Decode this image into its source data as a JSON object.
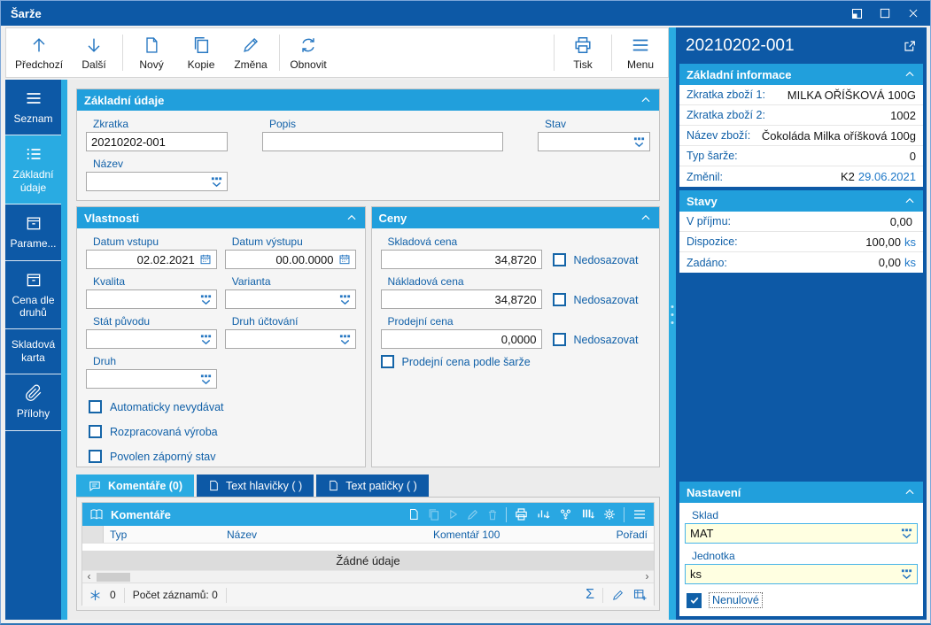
{
  "window": {
    "title": "Šarže"
  },
  "toolbar": {
    "buttons": [
      {
        "label": "Předchozí",
        "icon": "arrow-up-icon"
      },
      {
        "label": "Další",
        "icon": "arrow-down-icon"
      },
      {
        "label": "Nový",
        "icon": "new-document-icon"
      },
      {
        "label": "Kopie",
        "icon": "copy-icon"
      },
      {
        "label": "Změna",
        "icon": "pencil-icon"
      },
      {
        "label": "Obnovit",
        "icon": "refresh-icon"
      }
    ],
    "right_buttons": [
      {
        "label": "Tisk",
        "icon": "printer-icon"
      },
      {
        "label": "Menu",
        "icon": "hamburger-icon"
      }
    ]
  },
  "sidebar": {
    "items": [
      {
        "label": "Seznam",
        "icon": "hamburger-icon",
        "active": false
      },
      {
        "label": "Základní údaje",
        "icon": "list-icon",
        "active": true
      },
      {
        "label": "Parame...",
        "icon": "box-icon",
        "active": false
      },
      {
        "label": "Cena dle druhů",
        "icon": "box-icon",
        "active": false
      },
      {
        "label": "Skladová karta",
        "icon": "",
        "active": false
      },
      {
        "label": "Přílohy",
        "icon": "paperclip-icon",
        "active": false
      }
    ]
  },
  "sections": {
    "zakladni_udaje": {
      "title": "Základní údaje",
      "zkratka": {
        "label": "Zkratka",
        "value": "20210202-001"
      },
      "popis": {
        "label": "Popis",
        "value": ""
      },
      "stav": {
        "label": "Stav",
        "value": ""
      },
      "nazev": {
        "label": "Název",
        "value": ""
      }
    },
    "vlastnosti": {
      "title": "Vlastnosti",
      "datum_vstupu": {
        "label": "Datum vstupu",
        "value": "02.02.2021"
      },
      "datum_vystupu": {
        "label": "Datum výstupu",
        "value": "00.00.0000"
      },
      "kvalita": {
        "label": "Kvalita",
        "value": ""
      },
      "varianta": {
        "label": "Varianta",
        "value": ""
      },
      "stat_puvodu": {
        "label": "Stát původu",
        "value": ""
      },
      "druh_uctovani": {
        "label": "Druh účtování",
        "value": ""
      },
      "druh": {
        "label": "Druh",
        "value": ""
      },
      "checkboxes": [
        {
          "label": "Automaticky nevydávat",
          "checked": false
        },
        {
          "label": "Rozpracovaná výroba",
          "checked": false
        },
        {
          "label": "Povolen záporný stav",
          "checked": false
        }
      ]
    },
    "ceny": {
      "title": "Ceny",
      "rows": [
        {
          "label": "Skladová cena",
          "value": "34,8720",
          "checkbox": "Nedosazovat",
          "checked": false
        },
        {
          "label": "Nákladová cena",
          "value": "34,8720",
          "checkbox": "Nedosazovat",
          "checked": false
        },
        {
          "label": "Prodejní cena",
          "value": "0,0000",
          "checkbox": "Nedosazovat",
          "checked": false
        }
      ],
      "batch_price_checkbox": {
        "label": "Prodejní cena podle šarže",
        "checked": false
      }
    }
  },
  "tabs": [
    {
      "label": "Komentáře (0)",
      "icon": "comment-icon",
      "active": true
    },
    {
      "label": "Text hlavičky ( )",
      "icon": "document-icon",
      "active": false
    },
    {
      "label": "Text patičky ( )",
      "icon": "document-icon",
      "active": false
    }
  ],
  "comments_table": {
    "title": "Komentáře",
    "columns": [
      "Typ",
      "Název",
      "Komentář 100",
      "Pořadí"
    ],
    "empty_text": "Žádné údaje",
    "star_count": "0",
    "record_count_label": "Počet záznamů: 0"
  },
  "right_panel": {
    "title": "20210202-001",
    "basic_info": {
      "title": "Základní informace",
      "rows": [
        {
          "label": "Zkratka zboží 1:",
          "value": "MILKA OŘÍŠKOVÁ 100G"
        },
        {
          "label": "Zkratka zboží 2:",
          "value": "1002"
        },
        {
          "label": "Název zboží:",
          "value": "Čokoláda Milka oříšková 100g"
        },
        {
          "label": "Typ šarže:",
          "value": "0"
        }
      ],
      "changed_row": {
        "label": "Změnil:",
        "user": "K2",
        "date": "29.06.2021"
      }
    },
    "stavy": {
      "title": "Stavy",
      "rows": [
        {
          "label": "V příjmu:",
          "value": "0,00",
          "unit": ""
        },
        {
          "label": "Dispozice:",
          "value": "100,00",
          "unit": "ks"
        },
        {
          "label": "Zadáno:",
          "value": "0,00",
          "unit": "ks"
        }
      ]
    },
    "nastaveni": {
      "title": "Nastavení",
      "sklad": {
        "label": "Sklad",
        "value": "MAT"
      },
      "jednotka": {
        "label": "Jednotka",
        "value": "ks"
      },
      "checkbox": {
        "label": "Nenulové",
        "checked": true
      }
    }
  },
  "colors": {
    "titlebar": "#0d59a6",
    "accent": "#29abe2",
    "section_header": "#219fdc",
    "label_blue": "#1060a8",
    "icon_blue": "#2677c2",
    "input_yellow": "#ffffe1"
  }
}
